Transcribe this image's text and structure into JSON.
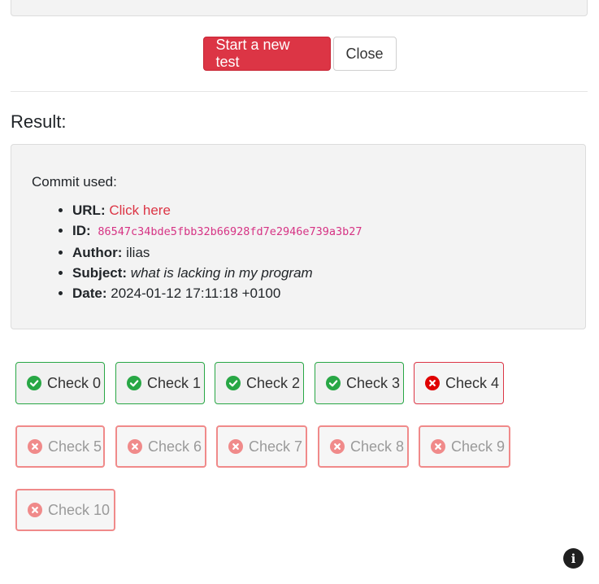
{
  "actions": {
    "start_label": "Start a new test",
    "close_label": "Close"
  },
  "result": {
    "title": "Result:",
    "commit_label": "Commit used:",
    "url_key": "URL:",
    "url_text": "Click here",
    "id_key": "ID:",
    "id_value": "86547c34bde5fbb32b66928fd7e2946e739a3b27",
    "author_key": "Author:",
    "author_value": "ilias",
    "subject_key": "Subject:",
    "subject_value": "what is lacking in my program",
    "date_key": "Date:",
    "date_value": "2024-01-12 17:11:18 +0100"
  },
  "checks": [
    {
      "label": "Check 0",
      "status": "pass",
      "icon": "check-circle-icon"
    },
    {
      "label": "Check 1",
      "status": "pass",
      "icon": "check-circle-icon"
    },
    {
      "label": "Check 2",
      "status": "pass",
      "icon": "check-circle-icon"
    },
    {
      "label": "Check 3",
      "status": "pass",
      "icon": "check-circle-icon"
    },
    {
      "label": "Check 4",
      "status": "fail",
      "icon": "x-circle-icon"
    },
    {
      "label": "Check 5",
      "status": "skipped",
      "icon": "x-circle-icon"
    },
    {
      "label": "Check 6",
      "status": "skipped",
      "icon": "x-circle-icon"
    },
    {
      "label": "Check 7",
      "status": "skipped",
      "icon": "x-circle-icon"
    },
    {
      "label": "Check 8",
      "status": "skipped",
      "icon": "x-circle-icon"
    },
    {
      "label": "Check 9",
      "status": "skipped",
      "icon": "x-circle-icon"
    },
    {
      "label": "Check 10",
      "status": "skipped",
      "icon": "x-circle-icon"
    }
  ],
  "colors": {
    "danger": "#dc3545",
    "success": "#28a745",
    "skipped": "#f08a8a"
  },
  "info_icon": "info-circle-icon"
}
